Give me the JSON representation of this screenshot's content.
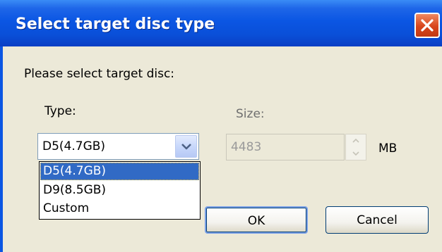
{
  "dialog": {
    "title": "Select target disc type",
    "close_icon": "close-icon"
  },
  "prompt": "Please select target disc:",
  "type": {
    "label": "Type:",
    "selected": "D5(4.7GB)",
    "options": [
      "D5(4.7GB)",
      "D9(8.5GB)",
      "Custom"
    ],
    "dropdown_open": true
  },
  "size": {
    "label": "Size:",
    "value": "4483",
    "unit": "MB",
    "enabled": false
  },
  "buttons": {
    "ok": "OK",
    "cancel": "Cancel"
  },
  "colors": {
    "titlebar": "#0b56e3",
    "close": "#d8451c",
    "selection": "#316ac5",
    "face": "#ece9d8"
  }
}
